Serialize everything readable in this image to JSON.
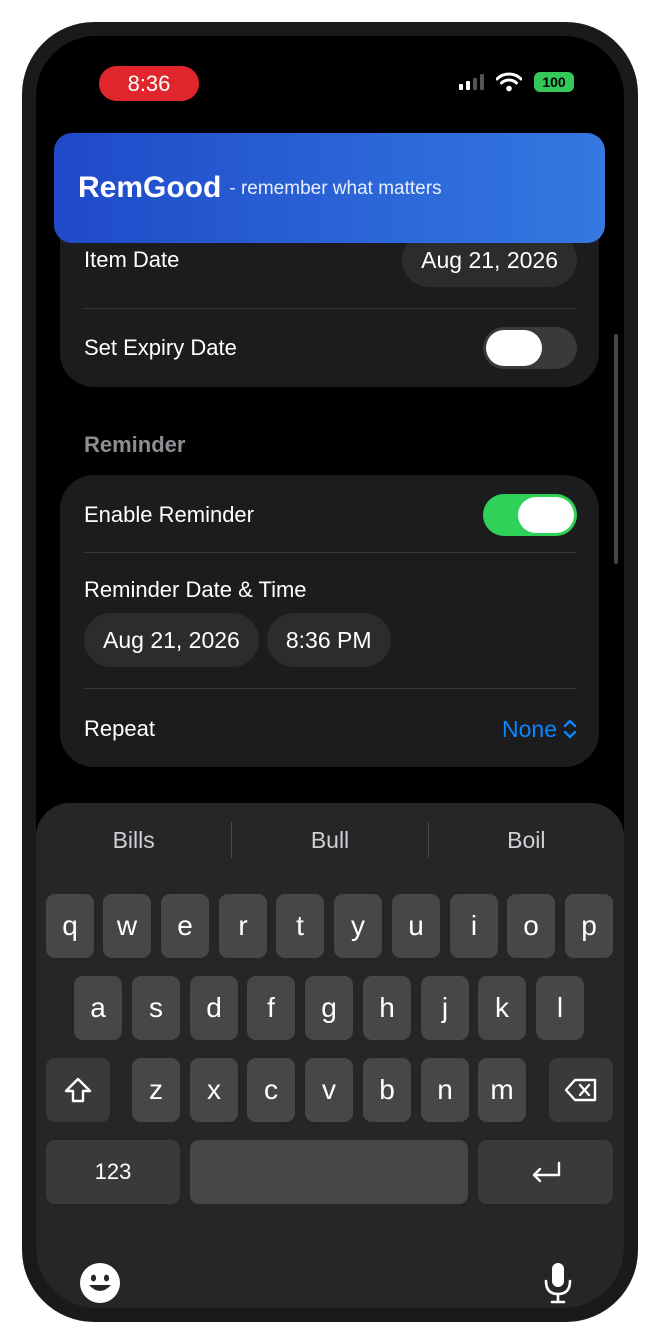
{
  "status_bar": {
    "time": "8:36",
    "battery": "100"
  },
  "banner": {
    "brand": "RemGood",
    "tagline": "- remember what matters"
  },
  "item_card": {
    "item_date_label": "Item Date",
    "item_date_value": "Aug 21, 2026",
    "expiry_label": "Set Expiry Date",
    "expiry_enabled": false
  },
  "reminder": {
    "section_header": "Reminder",
    "enable_label": "Enable Reminder",
    "enable_on": true,
    "datetime_label": "Reminder Date & Time",
    "date_value": "Aug 21, 2026",
    "time_value": "8:36 PM",
    "repeat_label": "Repeat",
    "repeat_value": "None"
  },
  "keyboard": {
    "suggestions": [
      "Bills",
      "Bull",
      "Boil"
    ],
    "row1": [
      "q",
      "w",
      "e",
      "r",
      "t",
      "y",
      "u",
      "i",
      "o",
      "p"
    ],
    "row2": [
      "a",
      "s",
      "d",
      "f",
      "g",
      "h",
      "j",
      "k",
      "l"
    ],
    "row3": [
      "z",
      "x",
      "c",
      "v",
      "b",
      "n",
      "m"
    ],
    "numbers_key": "123",
    "icons": {
      "shift": "shift-icon",
      "delete": "delete-icon",
      "return": "return-icon",
      "emoji": "emoji-icon",
      "mic": "microphone-icon"
    }
  },
  "colors": {
    "accent": "#0a84ff",
    "toggle_on": "#30d158",
    "time_pill": "#e0262c",
    "banner": "#2c67d8"
  }
}
